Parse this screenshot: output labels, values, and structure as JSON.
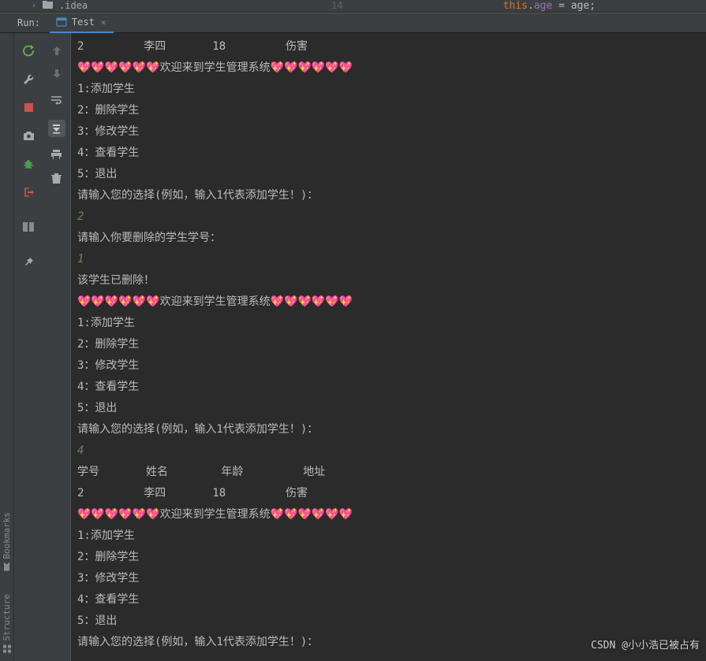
{
  "breadcrumb": {
    "chevron1": "›",
    "folder_icon": "📁",
    "folder": ".idea"
  },
  "editor": {
    "lineno": "14",
    "kw": "this",
    "punct1": ".",
    "name": "age",
    "eq": " = ",
    "var": "age",
    "semi": ";"
  },
  "runbar": {
    "label": "Run:",
    "tab_name": "Test",
    "close": "×"
  },
  "left_tabs": {
    "structure": "Structure",
    "bookmarks": "Bookmarks"
  },
  "console": {
    "lines": [
      {
        "t": "2         李四       18         伤害"
      },
      {
        "t": "💖💖💖💖💖💖欢迎来到学生管理系统💖💖💖💖💖💖"
      },
      {
        "t": "1:添加学生"
      },
      {
        "t": "2：删除学生"
      },
      {
        "t": "3：修改学生"
      },
      {
        "t": "4：查看学生"
      },
      {
        "t": "5：退出"
      },
      {
        "t": "请输入您的选择(例如，输入1代表添加学生！)："
      },
      {
        "t": "2",
        "cls": "g"
      },
      {
        "t": "请输入你要删除的学生学号："
      },
      {
        "t": "1",
        "cls": "g"
      },
      {
        "t": "该学生已删除！"
      },
      {
        "t": "💖💖💖💖💖💖欢迎来到学生管理系统💖💖💖💖💖💖"
      },
      {
        "t": "1:添加学生"
      },
      {
        "t": "2：删除学生"
      },
      {
        "t": "3：修改学生"
      },
      {
        "t": "4：查看学生"
      },
      {
        "t": "5：退出"
      },
      {
        "t": "请输入您的选择(例如，输入1代表添加学生！)："
      },
      {
        "t": "4",
        "cls": "g"
      },
      {
        "t": "学号       姓名        年龄         地址"
      },
      {
        "t": "2         李四       18         伤害"
      },
      {
        "t": "💖💖💖💖💖💖欢迎来到学生管理系统💖💖💖💖💖💖"
      },
      {
        "t": "1:添加学生"
      },
      {
        "t": "2：删除学生"
      },
      {
        "t": "3：修改学生"
      },
      {
        "t": "4：查看学生"
      },
      {
        "t": "5：退出"
      },
      {
        "t": "请输入您的选择(例如，输入1代表添加学生！)："
      }
    ]
  },
  "watermark": "CSDN @小小浩已被占有"
}
